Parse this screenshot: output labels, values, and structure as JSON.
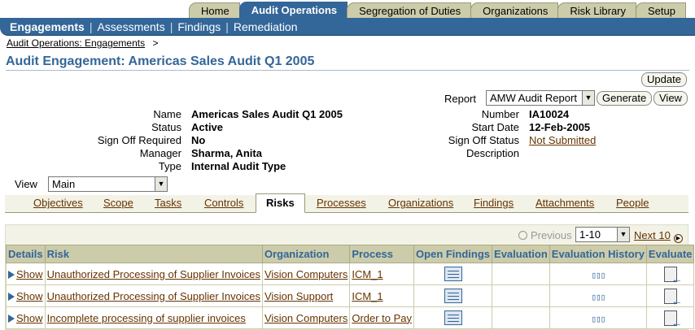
{
  "top_tabs": [
    "Home",
    "Audit Operations",
    "Segregation of Duties",
    "Organizations",
    "Risk Library",
    "Setup"
  ],
  "active_top_tab": "Audit Operations",
  "subnav": [
    "Engagements",
    "Assessments",
    "Findings",
    "Remediation"
  ],
  "breadcrumb": {
    "link": "Audit Operations: Engagements",
    "sep": ">"
  },
  "page_title": "Audit Engagement: Americas Sales Audit Q1 2005",
  "buttons": {
    "update": "Update",
    "generate": "Generate",
    "view": "View"
  },
  "report": {
    "label": "Report",
    "selected": "AMW Audit Report"
  },
  "details_left": [
    {
      "label": "Name",
      "value": "Americas Sales Audit Q1 2005"
    },
    {
      "label": "Status",
      "value": "Active"
    },
    {
      "label": "Sign Off Required",
      "value": "No"
    },
    {
      "label": "Manager",
      "value": "Sharma, Anita"
    },
    {
      "label": "Type",
      "value": "Internal Audit Type"
    }
  ],
  "details_right": [
    {
      "label": "Number",
      "value": "IA10024"
    },
    {
      "label": "Start Date",
      "value": "12-Feb-2005"
    },
    {
      "label": "Sign Off Status",
      "value": "Not Submitted"
    },
    {
      "label": "Description",
      "value": ""
    }
  ],
  "view_select": {
    "label": "View",
    "selected": "Main"
  },
  "sub_tabs": [
    "Objectives",
    "Scope",
    "Tasks",
    "Controls",
    "Risks",
    "Processes",
    "Organizations",
    "Findings",
    "Attachments",
    "People"
  ],
  "active_sub_tab": "Risks",
  "pager": {
    "previous": "Previous",
    "range": "1-10",
    "next": "Next 10"
  },
  "table": {
    "headers": [
      "Details",
      "Risk",
      "Organization",
      "Process",
      "Open Findings",
      "Evaluation",
      "Evaluation History",
      "Evaluate"
    ],
    "rows": [
      {
        "details": "Show",
        "risk": "Unauthorized Processing of Supplier Invoices",
        "organization": "Vision Computers",
        "process": "ICM_1",
        "evaluation": ""
      },
      {
        "details": "Show",
        "risk": "Unauthorized Processing of Supplier Invoices",
        "organization": "Vision Support",
        "process": "ICM_1",
        "evaluation": ""
      },
      {
        "details": "Show",
        "risk": "Incomplete processing of supplier invoices",
        "organization": "Vision Computers",
        "process": "Order to Pay",
        "evaluation": ""
      }
    ]
  }
}
